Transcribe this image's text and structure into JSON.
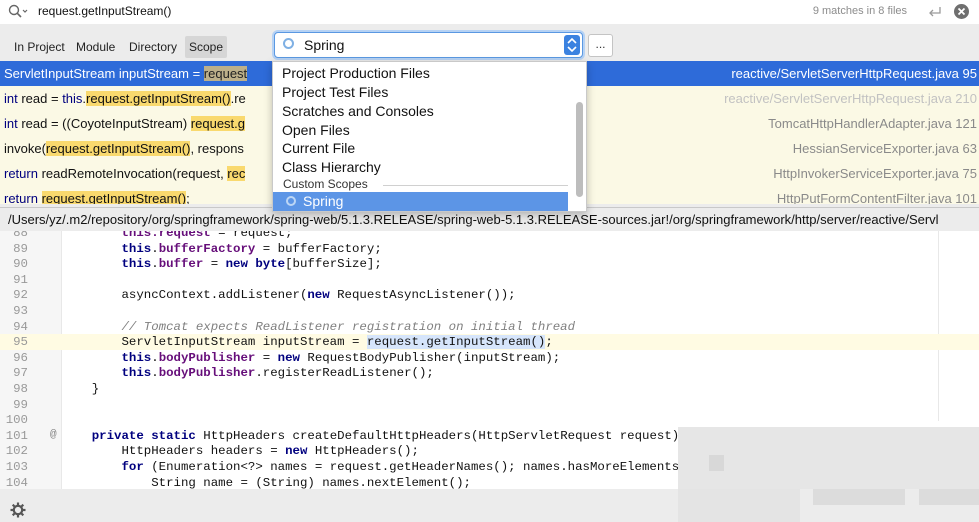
{
  "search": {
    "query": "request.getInputStream()",
    "match_count": "9 matches in 8 files"
  },
  "scope_tabs": [
    {
      "label": "In Project",
      "active": false
    },
    {
      "label": "Module",
      "active": false
    },
    {
      "label": "Directory",
      "active": false
    },
    {
      "label": "Scope",
      "active": true
    }
  ],
  "scope_combo": {
    "value": "Spring",
    "more_label": "..."
  },
  "dropdown": {
    "items": [
      "Project Production Files",
      "Project Test Files",
      "Scratches and Consoles",
      "Open Files",
      "Current File",
      "Class Hierarchy"
    ],
    "section_label": "Custom Scopes",
    "selected": "Spring"
  },
  "results": [
    {
      "prefix": "ServletInputStream inputStream = ",
      "match": "request",
      "suffix": "",
      "path": "reactive/ServletServerHttpRequest.java 95",
      "selected": true
    },
    {
      "prefix_kw": "int",
      "prefix": " read = ",
      "prefix2_kw": "this",
      "prefix2": ".",
      "match": "request.getInputStream()",
      "suffix": ".re",
      "path": "reactive/ServletServerHttpRequest.java 210"
    },
    {
      "prefix_kw": "int",
      "prefix": " read = ((CoyoteInputStream) ",
      "match": "request.g",
      "suffix": "",
      "path": "TomcatHttpHandlerAdapter.java 121"
    },
    {
      "prefix": "invoke(",
      "match": "request.getInputStream()",
      "suffix": ", respons",
      "path": "HessianServiceExporter.java 63"
    },
    {
      "prefix_kw": "return",
      "prefix": " readRemoteInvocation(request, ",
      "match": "rec",
      "suffix": "",
      "path": "HttpInvokerServiceExporter.java 75"
    },
    {
      "prefix_kw": "return",
      "prefix": " ",
      "match": "request.getInputStream()",
      "suffix": ";",
      "path": "HttpPutFormContentFilter.java 101"
    }
  ],
  "file_path": "/Users/yz/.m2/repository/org/springframework/spring-web/5.1.3.RELEASE/spring-web-5.1.3.RELEASE-sources.jar!/org/springframework/http/server/reactive/Servl",
  "editor_lines": [
    {
      "n": "88",
      "parts": [
        [
          "",
          "        "
        ],
        [
          "fld",
          "this.request"
        ],
        [
          "",
          " = request;"
        ]
      ]
    },
    {
      "n": "89",
      "parts": [
        [
          "",
          "        "
        ],
        [
          "kw",
          "this"
        ],
        [
          "",
          "."
        ],
        [
          "fld",
          "bufferFactory"
        ],
        [
          "",
          " = bufferFactory;"
        ]
      ]
    },
    {
      "n": "90",
      "parts": [
        [
          "",
          "        "
        ],
        [
          "kw",
          "this"
        ],
        [
          "",
          "."
        ],
        [
          "fld",
          "buffer"
        ],
        [
          "",
          " = "
        ],
        [
          "kw",
          "new"
        ],
        [
          "",
          " "
        ],
        [
          "kw",
          "byte"
        ],
        [
          "",
          "[bufferSize];"
        ]
      ]
    },
    {
      "n": "91",
      "parts": []
    },
    {
      "n": "92",
      "parts": [
        [
          "",
          "        asyncContext.addListener("
        ],
        [
          "kw",
          "new"
        ],
        [
          "",
          " RequestAsyncListener());"
        ]
      ]
    },
    {
      "n": "93",
      "parts": []
    },
    {
      "n": "94",
      "parts": [
        [
          "cmt",
          "        // Tomcat expects ReadListener registration on initial thread"
        ]
      ]
    },
    {
      "n": "95",
      "current": true,
      "parts": [
        [
          "",
          "        ServletInputStream inputStream = "
        ],
        [
          "sel",
          "request.getInputStream()"
        ],
        [
          "",
          ";"
        ]
      ]
    },
    {
      "n": "96",
      "parts": [
        [
          "",
          "        "
        ],
        [
          "kw",
          "this"
        ],
        [
          "",
          "."
        ],
        [
          "fld",
          "bodyPublisher"
        ],
        [
          "",
          " = "
        ],
        [
          "kw",
          "new"
        ],
        [
          "",
          " RequestBodyPublisher(inputStream);"
        ]
      ]
    },
    {
      "n": "97",
      "parts": [
        [
          "",
          "        "
        ],
        [
          "kw",
          "this"
        ],
        [
          "",
          "."
        ],
        [
          "fld",
          "bodyPublisher"
        ],
        [
          "",
          ".registerReadListener();"
        ]
      ]
    },
    {
      "n": "98",
      "parts": [
        [
          "",
          "    }"
        ]
      ]
    },
    {
      "n": "99",
      "parts": []
    },
    {
      "n": "100",
      "parts": []
    },
    {
      "n": "101",
      "ann": "@",
      "parts": [
        [
          "",
          "    "
        ],
        [
          "kw",
          "private"
        ],
        [
          "",
          " "
        ],
        [
          "kw",
          "static"
        ],
        [
          "",
          " HttpHeaders createDefaultHttpHeaders(HttpServletRequest request) {"
        ]
      ]
    },
    {
      "n": "102",
      "parts": [
        [
          "",
          "        HttpHeaders headers = "
        ],
        [
          "kw",
          "new"
        ],
        [
          "",
          " HttpHeaders();"
        ]
      ]
    },
    {
      "n": "103",
      "parts": [
        [
          "",
          "        "
        ],
        [
          "kw",
          "for"
        ],
        [
          "",
          " (Enumeration<?> names = request.getHeaderNames(); names.hasMoreElements();"
        ]
      ]
    },
    {
      "n": "104",
      "parts": [
        [
          "",
          "            String name = (String) names.nextElement();"
        ]
      ]
    }
  ]
}
